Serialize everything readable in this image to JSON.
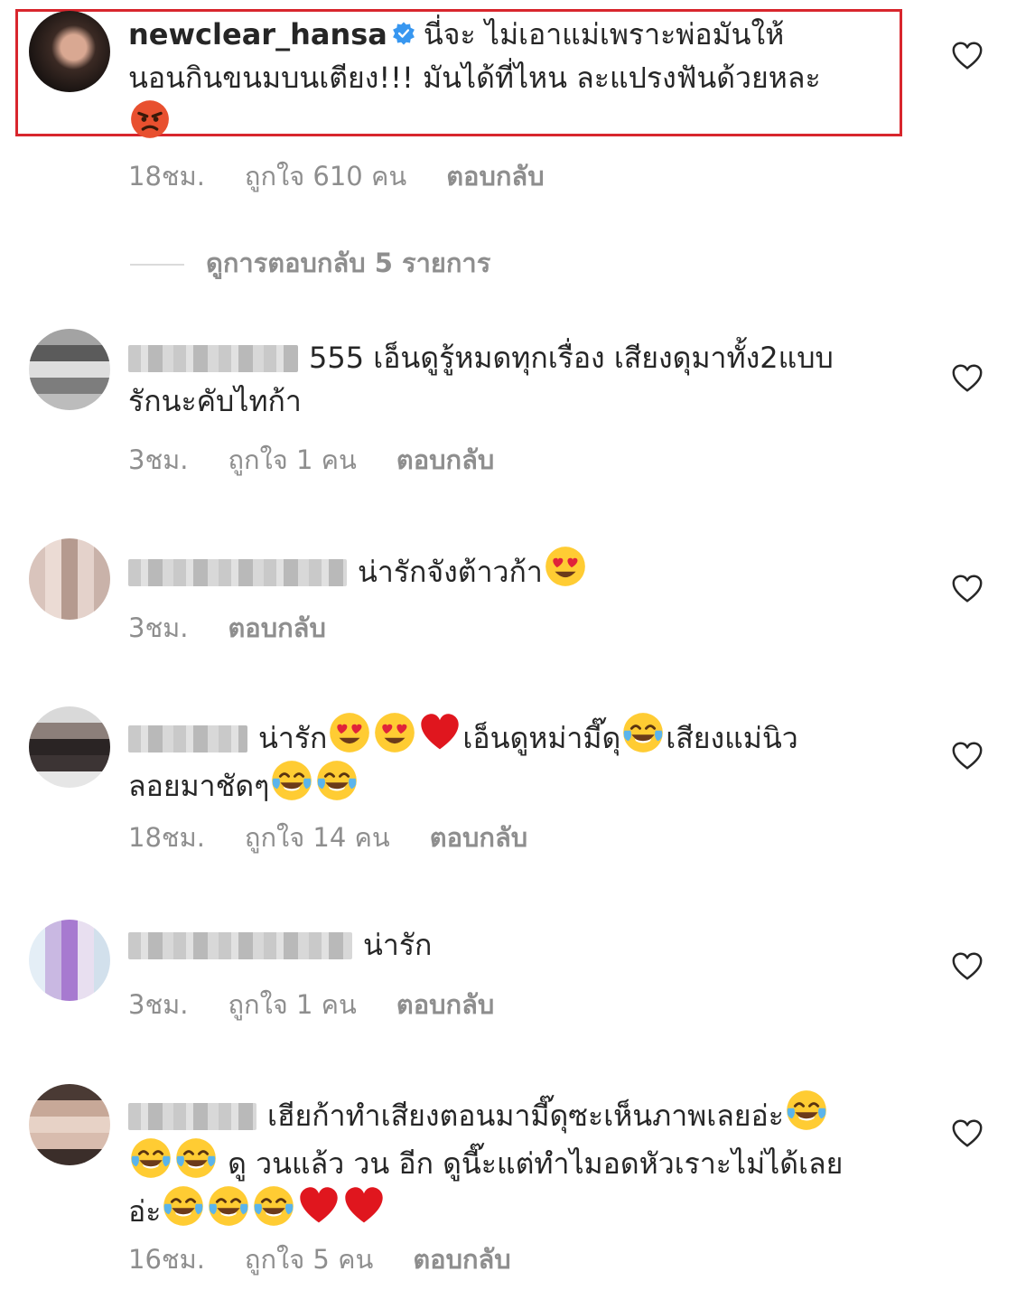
{
  "comments": [
    {
      "username": "newclear_hansa",
      "verified": true,
      "text_line1": "นี่จะ ไม่เอาแม่เพราะพ่อมันให้",
      "text_line2": "นอนกินขนมบนเตียง!!! มันได้ที่ไหน ละแปรงฟันด้วยหละ",
      "time": "18ชม.",
      "likes": "ถูกใจ 610 คน",
      "reply": "ตอบกลับ"
    },
    {
      "text_line1": "555 เอ็นดูรู้หมดทุกเรื่อง เสียงดุมาทั้ง2แบบ",
      "text_line2": "รักนะคับไทก้า",
      "time": "3ชม.",
      "likes": "ถูกใจ 1 คน",
      "reply": "ตอบกลับ"
    },
    {
      "text_line1": "น่ารักจังต้าวก้า",
      "time": "3ชม.",
      "reply": "ตอบกลับ"
    },
    {
      "text_a": "น่ารัก",
      "text_b": "เอ็นดูหม่ามี๊ดุ",
      "text_c": "เสียงแม่นิว",
      "text_line2": "ลอยมาชัดๆ",
      "time": "18ชม.",
      "likes": "ถูกใจ 14 คน",
      "reply": "ตอบกลับ"
    },
    {
      "text_line1": "น่ารัก",
      "time": "3ชม.",
      "likes": "ถูกใจ 1 คน",
      "reply": "ตอบกลับ"
    },
    {
      "text_line1": "เฮียก้าทำเสียงตอนมามี๊ดุซะเห็นภาพเลยอ่ะ",
      "text_line2": "ดู วนแล้ว วน อีก ดูนี๊ะแต่ทำไมอดหัวเราะไม่ได้เลย",
      "text_line3": "อ่ะ",
      "time": "16ชม.",
      "likes": "ถูกใจ 5 คน",
      "reply": "ตอบกลับ"
    }
  ],
  "view_replies": "ดูการตอบกลับ 5 รายการ",
  "colors": {
    "text": "#262626",
    "meta": "#8e8e8e",
    "verified": "#3897f0",
    "highlight": "#d8262d"
  },
  "icons": [
    "verified-badge-icon",
    "heart-outline-icon",
    "angry-face-emoji",
    "heart-eyes-emoji",
    "red-heart-emoji",
    "tears-of-joy-emoji"
  ]
}
